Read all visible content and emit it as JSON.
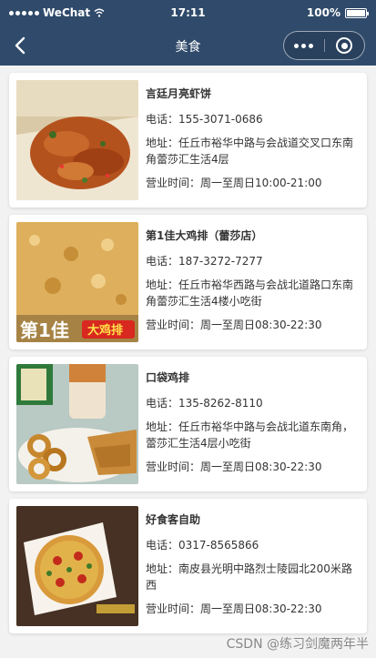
{
  "status_bar": {
    "carrier": "WeChat",
    "time": "17:11",
    "battery": "100%"
  },
  "nav": {
    "title": "美食",
    "back_icon": "chevron-left-icon",
    "more_icon": "more-dots-icon",
    "close_icon": "target-icon"
  },
  "restaurants": [
    {
      "name": "言廷月亮虾饼",
      "phone": "电话：155-3071-0686",
      "address": "地址：任丘市裕华中路与会战道交叉口东南角蕾莎汇生活4层",
      "hours": "营业时间：周一至周日10:00-21:00",
      "image": "food-photo-shrimp-cake"
    },
    {
      "name": "第1佳大鸡排（蕾莎店）",
      "phone": "电话：187-3272-7277",
      "address": "地址：任丘市裕华西路与会战北道路口东南角蕾莎汇生活4楼小吃街",
      "hours": "营业时间：周一至周日08:30-22:30",
      "image": "food-photo-chicken-cutlet",
      "image_text": [
        "第1佳",
        "大鸡排"
      ]
    },
    {
      "name": "口袋鸡排",
      "phone": "电话：135-8262-8110",
      "address": "地址：任丘市裕华中路与会战北道东南角，蕾莎汇生活4层小吃街",
      "hours": "营业时间：周一至周日08:30-22:30",
      "image": "food-photo-fried-chicken"
    },
    {
      "name": "好食客自助",
      "phone": "电话：0317-8565866",
      "address": "地址：南皮县光明中路烈士陵园北200米路西",
      "hours": "营业时间：周一至周日08:30-22:30",
      "image": "food-photo-pizza"
    }
  ],
  "watermark": "CSDN @练习剑魔两年半"
}
